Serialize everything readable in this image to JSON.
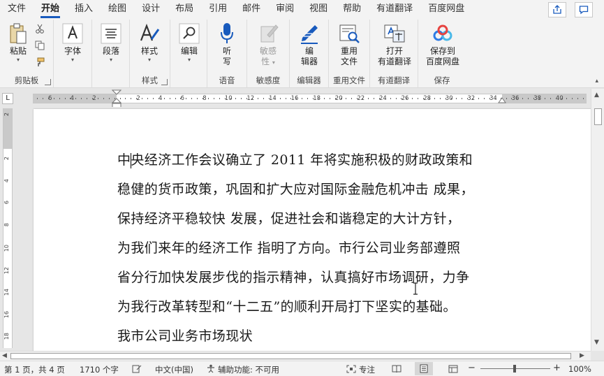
{
  "menu": {
    "tabs": [
      "文件",
      "开始",
      "插入",
      "绘图",
      "设计",
      "布局",
      "引用",
      "邮件",
      "审阅",
      "视图",
      "帮助",
      "有道翻译",
      "百度网盘"
    ],
    "active_tab": "开始"
  },
  "ribbon": {
    "clipboard": {
      "paste": "粘贴",
      "group": "剪贴板"
    },
    "font": {
      "label": "字体"
    },
    "paragraph": {
      "label": "段落"
    },
    "styles": {
      "label": "样式",
      "group": "样式"
    },
    "editing": {
      "label": "编辑"
    },
    "voice": {
      "label_1": "听",
      "label_2": "写",
      "group": "语音"
    },
    "sensitivity": {
      "label_1": "敏感",
      "label_2": "性",
      "group": "敏感度"
    },
    "editor": {
      "label_1": "编",
      "label_2": "辑器",
      "group": "编辑器"
    },
    "reuse": {
      "label_1": "重用",
      "label_2": "文件",
      "group": "重用文件"
    },
    "youdao": {
      "label_1": "打开",
      "label_2": "有道翻译",
      "group": "有道翻译"
    },
    "baidu": {
      "label_1": "保存到",
      "label_2": "百度网盘",
      "group": "保存"
    }
  },
  "ruler": {
    "numbers": [
      "6",
      "4",
      "2",
      "",
      "2",
      "4",
      "6",
      "8",
      "10",
      "12",
      "14",
      "16",
      "18",
      "20",
      "22",
      "24",
      "26",
      "28",
      "30",
      "32",
      "34",
      "36",
      "38",
      "40"
    ],
    "vertical_numbers": [
      "2",
      "",
      "2",
      "4",
      "6",
      "8",
      "10",
      "12",
      "14",
      "16",
      "18"
    ]
  },
  "document": {
    "line_0_before_cursor": "中",
    "line_0_after_cursor": "央经济工作会议确立了 2011 年将实施积极的财政政策和",
    "lines": [
      "稳健的货币政策，巩固和扩大应对国际金融危机冲击 成果，",
      "保持经济平稳较快 发展，促进社会和谐稳定的大计方针，",
      "为我们来年的经济工作 指明了方向。市行公司业务部遵照",
      "省分行加快发展步伐的指示精神，认真搞好市场调研，力争",
      "为我行改革转型和“十二五”的顺利开局打下坚实的基础。",
      "我市公司业务市场现状"
    ]
  },
  "status": {
    "page": "第 1 页，共 4 页",
    "words": "1710 个字",
    "language": "中文(中国)",
    "accessibility": "辅助功能: 不可用",
    "focus": "专注",
    "zoom": "100%"
  },
  "colors": {
    "accent": "#185abd",
    "ribbon_bg": "#f3f3f3",
    "workspace_bg": "#e6e6e6"
  }
}
